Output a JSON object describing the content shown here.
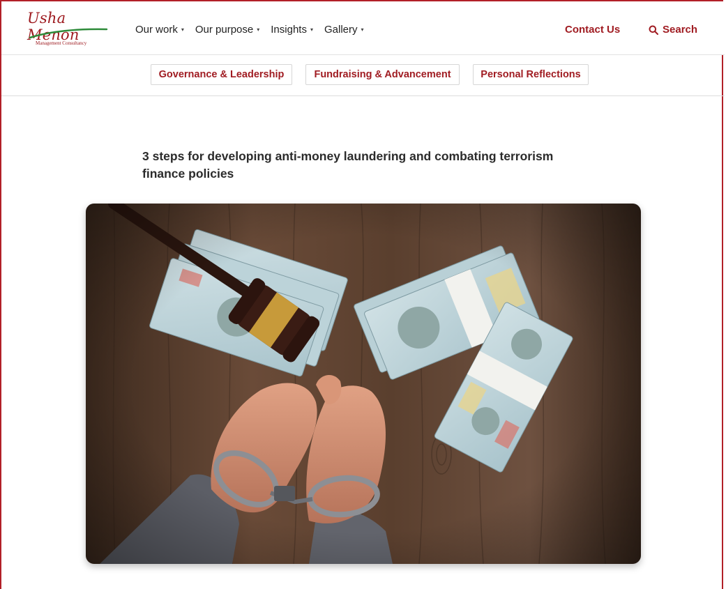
{
  "brand": {
    "name": "Usha Menon",
    "tagline": "Management Consultancy",
    "color": "#a01c22"
  },
  "nav": {
    "items": [
      {
        "label": "Our work",
        "icon": "chevron-down-icon"
      },
      {
        "label": "Our purpose",
        "icon": "chevron-down-icon"
      },
      {
        "label": "Insights",
        "icon": "chevron-down-icon"
      },
      {
        "label": "Gallery",
        "icon": "chevron-down-icon"
      }
    ],
    "contact_label": "Contact Us",
    "search_label": "Search",
    "search_icon": "search-icon"
  },
  "categories": [
    {
      "label": "Governance & Leadership"
    },
    {
      "label": "Fundraising & Advancement"
    },
    {
      "label": "Personal Reflections"
    }
  ],
  "article": {
    "title": "3 steps for developing anti-money laundering and combating terrorism finance policies",
    "image_alt": "Handcuffed hands next to a gavel and stacks of 100 dollar bills on a wooden table"
  }
}
